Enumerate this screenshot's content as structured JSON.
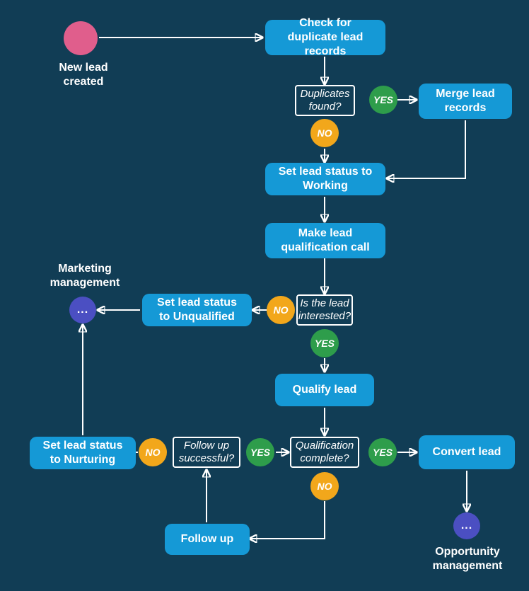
{
  "start": {
    "label": "New lead\ncreated"
  },
  "steps": {
    "check_dup": "Check for duplicate lead records",
    "merge": "Merge lead records",
    "set_working": "Set lead status to Working",
    "qual_call": "Make lead qualification call",
    "set_unqual": "Set lead status to Unqualified",
    "qualify": "Qualify lead",
    "set_nurture": "Set lead status to Nurturing",
    "followup": "Follow up",
    "convert": "Convert lead"
  },
  "decisions": {
    "dup_found": "Duplicates found?",
    "interested": "Is the lead interested?",
    "followup_ok": "Follow up successful?",
    "qual_complete": "Qualification complete?"
  },
  "answers": {
    "yes": "YES",
    "no": "NO"
  },
  "endpoints": {
    "marketing": "Marketing management",
    "opportunity": "Opportunity management"
  },
  "ellipsis": "..."
}
